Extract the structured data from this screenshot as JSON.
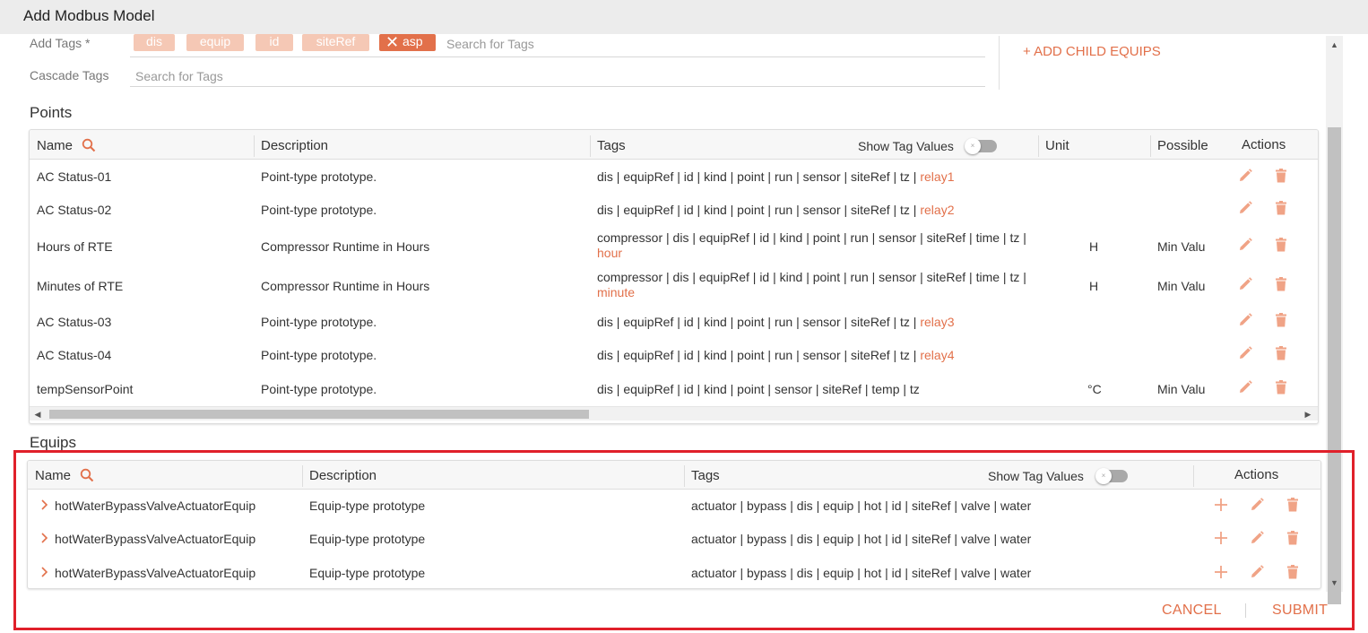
{
  "title": "Add Modbus Model",
  "form": {
    "add_tags_label": "Add Tags *",
    "tags": [
      "dis",
      "equip",
      "id",
      "siteRef"
    ],
    "active_tag": "asp",
    "search_placeholder": "Search for Tags",
    "cascade_label": "Cascade Tags",
    "cascade_placeholder": "Search for Tags",
    "add_child_equips": "+ ADD CHILD EQUIPS"
  },
  "points": {
    "title": "Points",
    "headers": {
      "name": "Name",
      "description": "Description",
      "tags": "Tags",
      "show_tag_values": "Show Tag Values",
      "unit": "Unit",
      "possible": "Possible",
      "actions": "Actions"
    },
    "rows": [
      {
        "name": "AC Status-01",
        "description": "Point-type prototype.",
        "tags": "dis | equipRef | id | kind | point | run | sensor | siteRef | tz |",
        "tag_value": "relay1",
        "unit": "",
        "possible": ""
      },
      {
        "name": "AC Status-02",
        "description": "Point-type prototype.",
        "tags": "dis | equipRef | id | kind | point | run | sensor | siteRef | tz |",
        "tag_value": "relay2",
        "unit": "",
        "possible": ""
      },
      {
        "name": "Hours of RTE",
        "description": "Compressor Runtime in Hours",
        "tags": "compressor | dis | equipRef | id | kind | point | run | sensor | siteRef | time | tz |",
        "tag_value": "hour",
        "unit": "H",
        "possible": "Min Valu"
      },
      {
        "name": "Minutes of RTE",
        "description": "Compressor Runtime in Hours",
        "tags": "compressor | dis | equipRef | id | kind | point | run | sensor | siteRef | time | tz |",
        "tag_value": "minute",
        "unit": "H",
        "possible": "Min Valu"
      },
      {
        "name": "AC Status-03",
        "description": "Point-type prototype.",
        "tags": "dis | equipRef | id | kind | point | run | sensor | siteRef | tz |",
        "tag_value": "relay3",
        "unit": "",
        "possible": ""
      },
      {
        "name": "AC Status-04",
        "description": "Point-type prototype.",
        "tags": "dis | equipRef | id | kind | point | run | sensor | siteRef | tz |",
        "tag_value": "relay4",
        "unit": "",
        "possible": ""
      },
      {
        "name": "tempSensorPoint",
        "description": "Point-type prototype.",
        "tags": "dis | equipRef | id | kind | point | sensor | siteRef | temp | tz",
        "tag_value": "",
        "unit": "°C",
        "possible": "Min Valu"
      }
    ]
  },
  "equips": {
    "title": "Equips",
    "headers": {
      "name": "Name",
      "description": "Description",
      "tags": "Tags",
      "show_tag_values": "Show Tag Values",
      "actions": "Actions"
    },
    "rows": [
      {
        "name": "hotWaterBypassValveActuatorEquip",
        "description": "Equip-type prototype",
        "tags": "actuator | bypass | dis | equip | hot | id | siteRef | valve | water"
      },
      {
        "name": "hotWaterBypassValveActuatorEquip",
        "description": "Equip-type prototype",
        "tags": "actuator | bypass | dis | equip | hot | id | siteRef | valve | water"
      },
      {
        "name": "hotWaterBypassValveActuatorEquip",
        "description": "Equip-type prototype",
        "tags": "actuator | bypass | dis | equip | hot | id | siteRef | valve | water"
      }
    ]
  },
  "footer": {
    "cancel": "CANCEL",
    "submit": "SUBMIT"
  },
  "colors": {
    "accent": "#e2704a",
    "chip": "#f5c8b5",
    "highlight_box": "#e0202a"
  },
  "icons": [
    "search-icon",
    "pencil-icon",
    "trash-icon",
    "plus-icon",
    "chevron-right-icon",
    "close-icon"
  ]
}
